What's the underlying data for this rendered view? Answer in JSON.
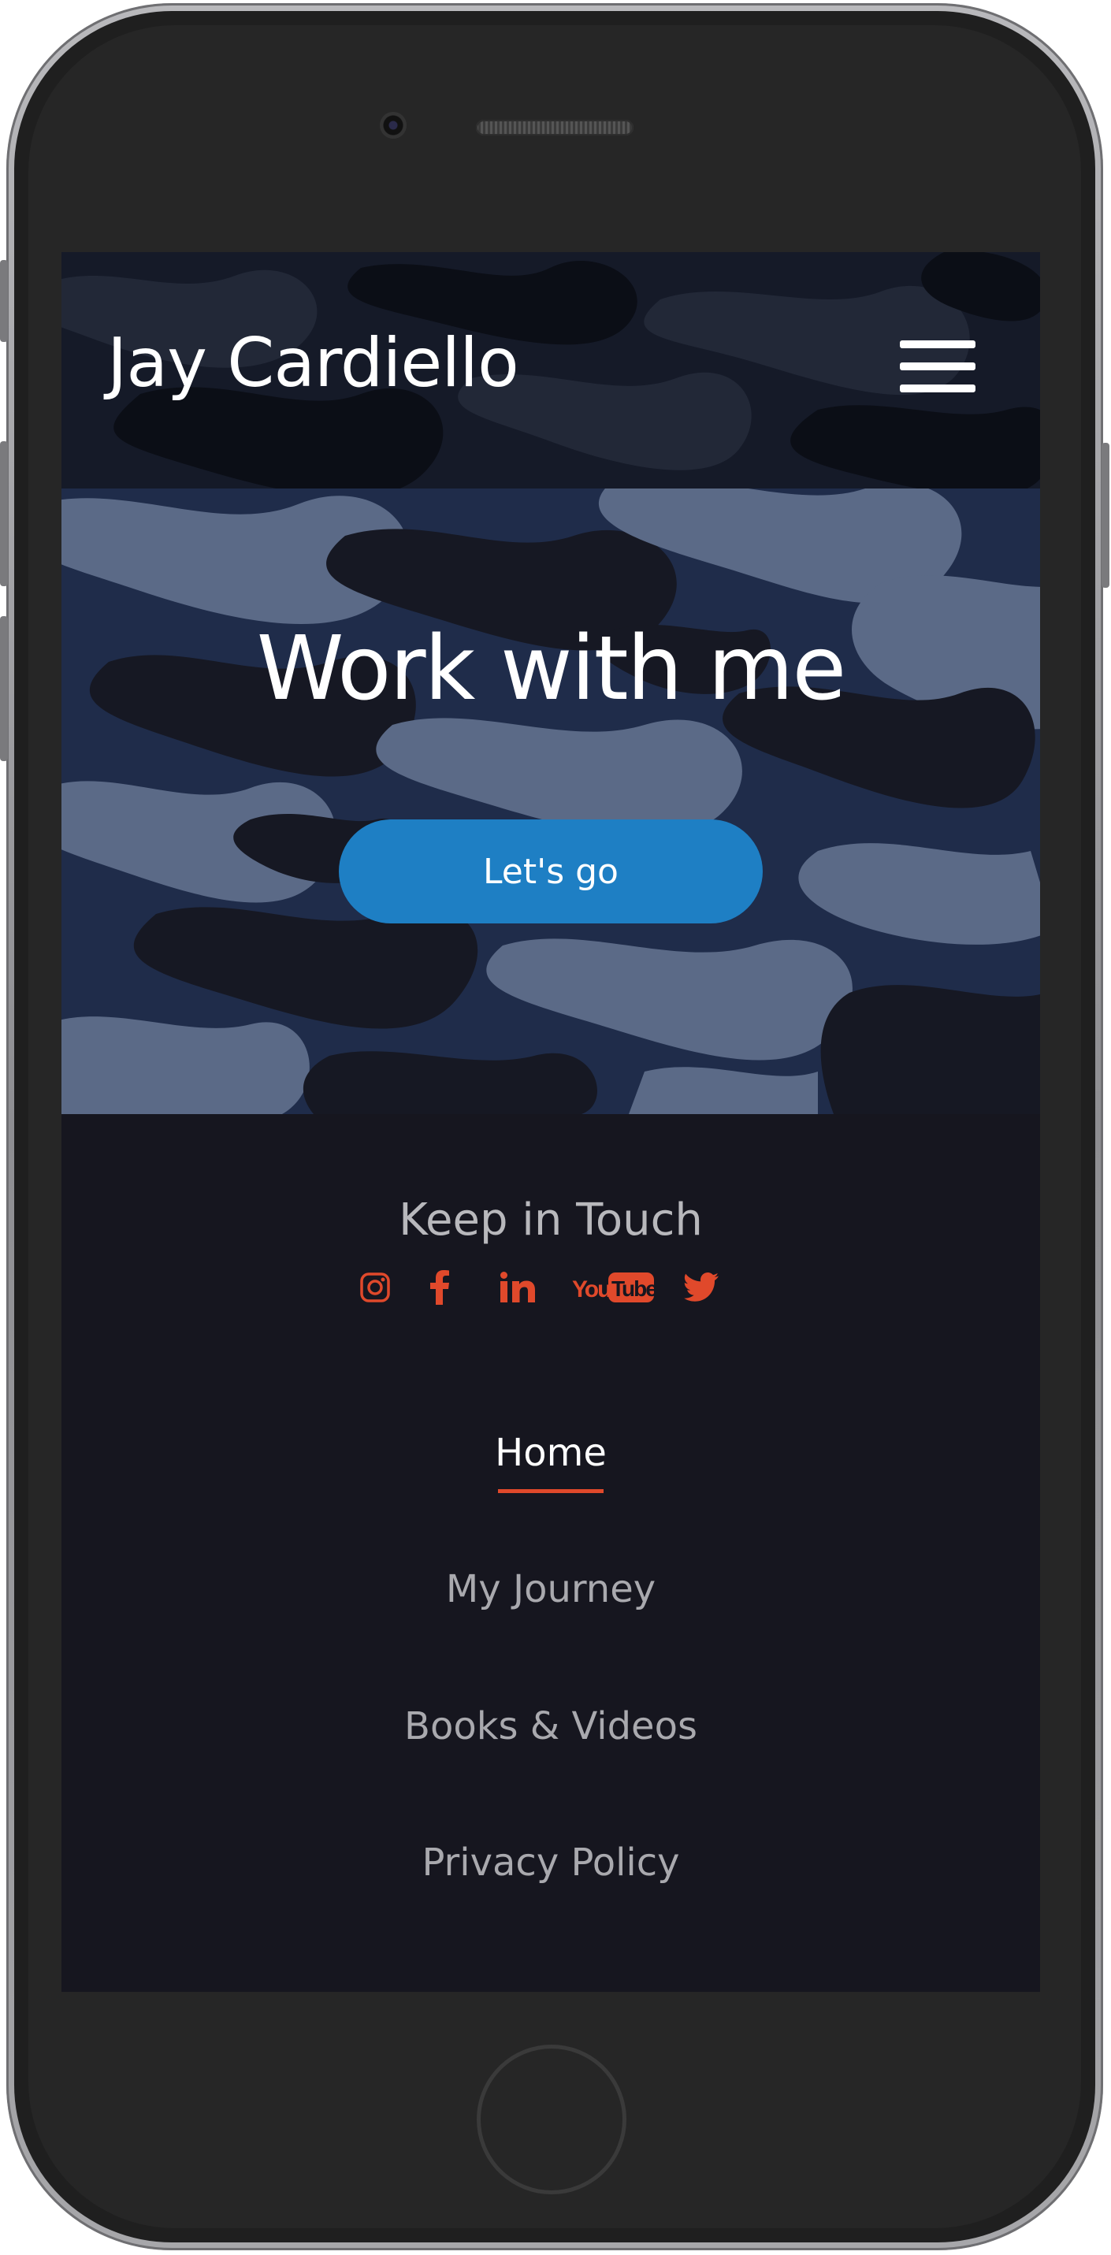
{
  "site": {
    "title": "Jay Cardiello"
  },
  "hero": {
    "heading": "Work with me",
    "cta_label": "Let's go"
  },
  "footer": {
    "heading": "Keep in Touch",
    "social_icons": [
      "instagram-icon",
      "facebook-icon",
      "linkedin-icon",
      "youtube-icon",
      "twitter-icon"
    ],
    "youtube_text_you": "You",
    "youtube_text_tube": "Tube"
  },
  "nav": {
    "items": [
      {
        "label": "Home",
        "active": true
      },
      {
        "label": "My Journey",
        "active": false
      },
      {
        "label": "Books & Videos",
        "active": false
      },
      {
        "label": "Privacy Policy",
        "active": false
      }
    ]
  },
  "colors": {
    "accent": "#e0492b",
    "button_blue": "#1e7fc4",
    "footer_bg": "#16161f",
    "camo_light": "#5b6a87",
    "camo_mid": "#1f2c4a",
    "camo_dark": "#161823"
  }
}
